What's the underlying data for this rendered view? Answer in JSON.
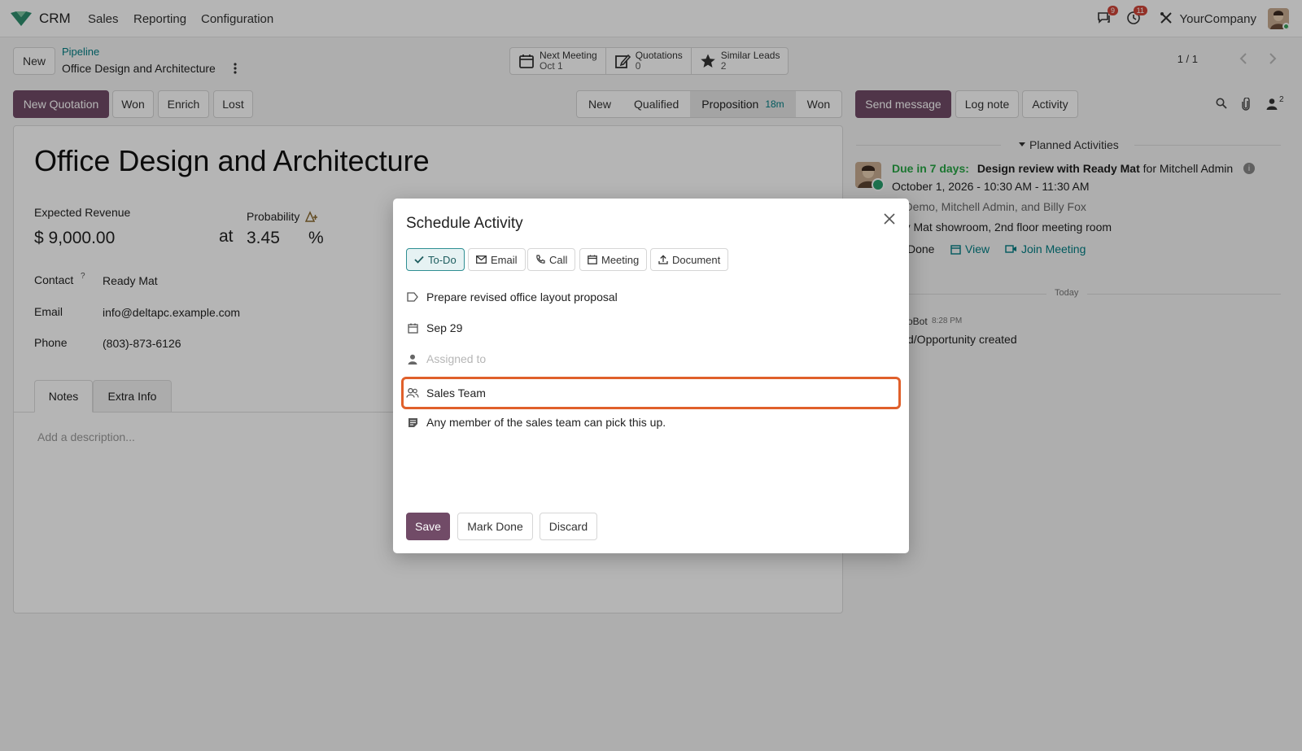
{
  "topnav": {
    "app_name": "CRM",
    "menu": [
      "Sales",
      "Reporting",
      "Configuration"
    ],
    "messages_count": "9",
    "activities_count": "11",
    "company": "YourCompany"
  },
  "control": {
    "new_label": "New",
    "breadcrumb_parent": "Pipeline",
    "breadcrumb_current": "Office Design and Architecture",
    "pager": "1 / 1",
    "stats": [
      {
        "label": "Next Meeting",
        "value": "Oct 1"
      },
      {
        "label": "Quotations",
        "value": "0"
      },
      {
        "label": "Similar Leads",
        "value": "2"
      }
    ]
  },
  "actions": {
    "new_quotation": "New Quotation",
    "won": "Won",
    "enrich": "Enrich",
    "lost": "Lost"
  },
  "stages": {
    "items": [
      "New",
      "Qualified",
      "Proposition",
      "Won"
    ],
    "active": "Proposition",
    "active_time": "18m"
  },
  "form": {
    "title": "Office Design and Architecture",
    "expected_revenue_label": "Expected Revenue",
    "expected_revenue": "$ 9,000.00",
    "at": "at",
    "probability_label": "Probability",
    "probability": "3.45",
    "percent": "%",
    "contact_label": "Contact",
    "contact_help": "?",
    "contact": "Ready Mat",
    "email_label": "Email",
    "email": "info@deltapc.example.com",
    "phone_label": "Phone",
    "phone": "(803)-873-6126",
    "tabs": [
      "Notes",
      "Extra Info"
    ],
    "description_placeholder": "Add a description..."
  },
  "chatter": {
    "send_message": "Send message",
    "log_note": "Log note",
    "activity": "Activity",
    "followers_count": "2",
    "planned_activities": "Planned Activities",
    "activity_due": "Due in 7 days:",
    "activity_title": "Design review with Ready Mat",
    "activity_for": "for Mitchell Admin",
    "activity_time": "October 1, 2026 - 10:30 AM - 11:30 AM",
    "attendees": "rc Demo, Mitchell Admin, and Billy Fox",
    "location": "ady Mat showroom, 2nd floor meeting room",
    "done": "Done",
    "view": "View",
    "join_meeting": "Join Meeting",
    "today": "Today",
    "log_author": "oBot",
    "log_time": "8:28 PM",
    "log_text": "d/Opportunity created"
  },
  "modal": {
    "title": "Schedule Activity",
    "types": [
      "To-Do",
      "Email",
      "Call",
      "Meeting",
      "Document"
    ],
    "active_type": "To-Do",
    "summary": "Prepare revised office layout proposal",
    "due_date": "Sep 29",
    "assigned_placeholder": "Assigned to",
    "team": "Sales Team",
    "note": "Any member of the sales team can pick this up.",
    "save": "Save",
    "mark_done": "Mark Done",
    "discard": "Discard"
  },
  "colors": {
    "brand": "#714b67",
    "link": "#017e84",
    "due": "#28a745",
    "focus": "#e0602b"
  }
}
